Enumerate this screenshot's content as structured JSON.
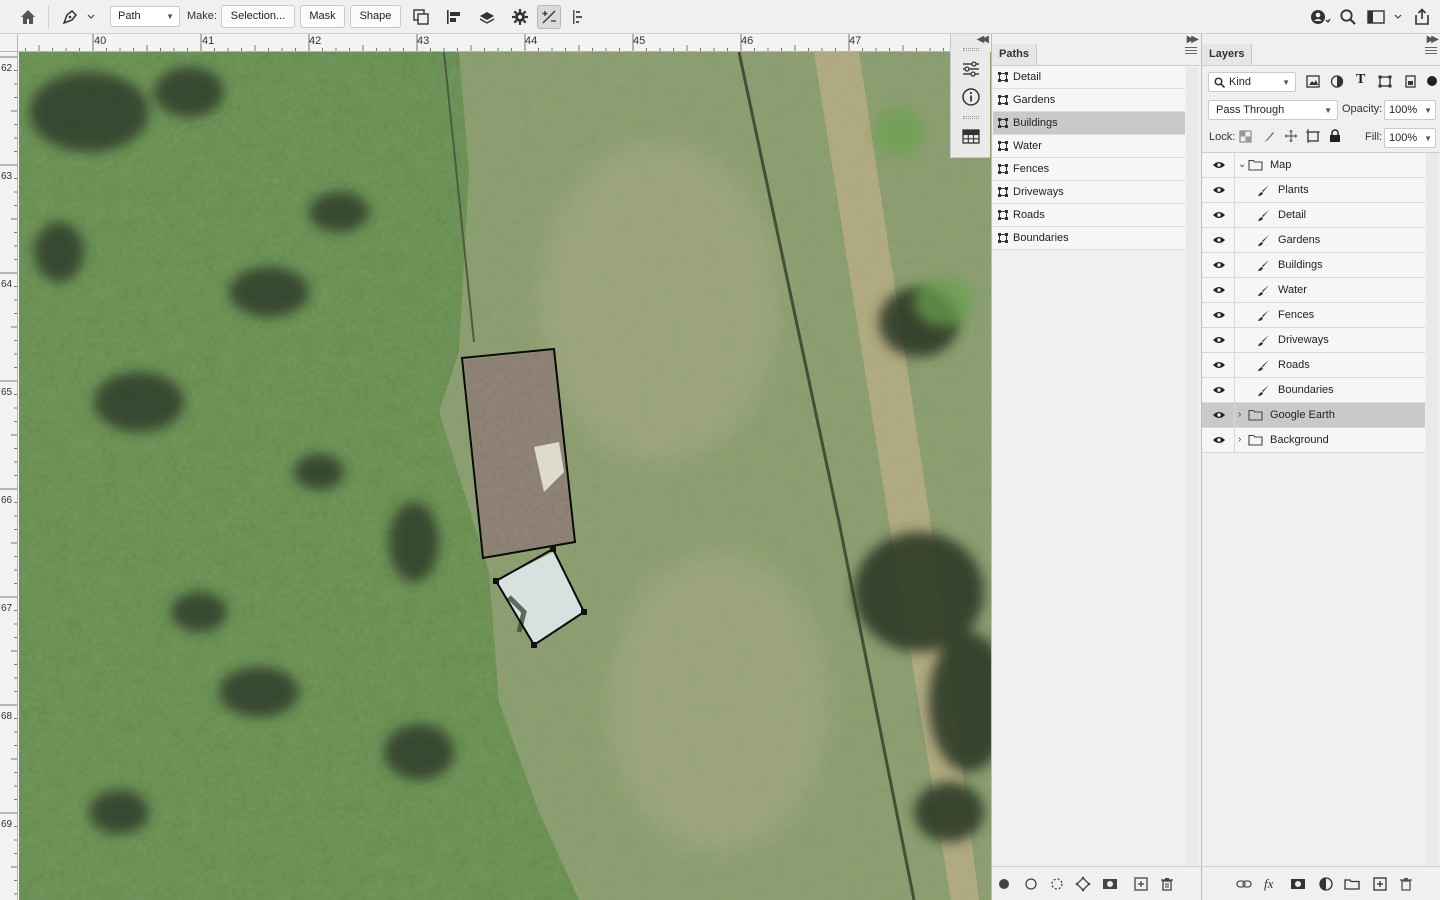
{
  "options_bar": {
    "tool_mode": "Path",
    "make_label": "Make:",
    "selection_button": "Selection...",
    "mask_button": "Mask",
    "shape_button": "Shape"
  },
  "rulers": {
    "horizontal": [
      "40",
      "41",
      "42",
      "43",
      "44",
      "45",
      "46",
      "47"
    ],
    "vertical": [
      "62",
      "63",
      "64",
      "65",
      "66",
      "67",
      "68",
      "69"
    ]
  },
  "paths_panel": {
    "tab": "Paths",
    "items": [
      {
        "label": "Detail",
        "selected": false
      },
      {
        "label": "Gardens",
        "selected": false
      },
      {
        "label": "Buildings",
        "selected": true
      },
      {
        "label": "Water",
        "selected": false
      },
      {
        "label": "Fences",
        "selected": false
      },
      {
        "label": "Driveways",
        "selected": false
      },
      {
        "label": "Roads",
        "selected": false
      },
      {
        "label": "Boundaries",
        "selected": false
      }
    ]
  },
  "layers_panel": {
    "tab": "Layers",
    "filter": "Kind",
    "blend_mode": "Pass Through",
    "opacity_label": "Opacity:",
    "opacity": "100%",
    "lock_label": "Lock:",
    "fill_label": "Fill:",
    "fill": "100%",
    "layers": [
      {
        "label": "Map",
        "type": "group",
        "expanded": true,
        "selected": false
      },
      {
        "label": "Plants",
        "type": "layer",
        "selected": false
      },
      {
        "label": "Detail",
        "type": "layer",
        "selected": false
      },
      {
        "label": "Gardens",
        "type": "layer",
        "selected": false
      },
      {
        "label": "Buildings",
        "type": "layer",
        "selected": false
      },
      {
        "label": "Water",
        "type": "layer",
        "selected": false
      },
      {
        "label": "Fences",
        "type": "layer",
        "selected": false
      },
      {
        "label": "Driveways",
        "type": "layer",
        "selected": false
      },
      {
        "label": "Roads",
        "type": "layer",
        "selected": false
      },
      {
        "label": "Boundaries",
        "type": "layer",
        "selected": false
      },
      {
        "label": "Google Earth",
        "type": "group",
        "expanded": false,
        "selected": true
      },
      {
        "label": "Background",
        "type": "group",
        "expanded": false,
        "selected": false
      }
    ]
  },
  "colors": {
    "selected_row": "#c9c9c9",
    "grass": "#8d9a6a",
    "foliage": "#4f7a3a"
  }
}
